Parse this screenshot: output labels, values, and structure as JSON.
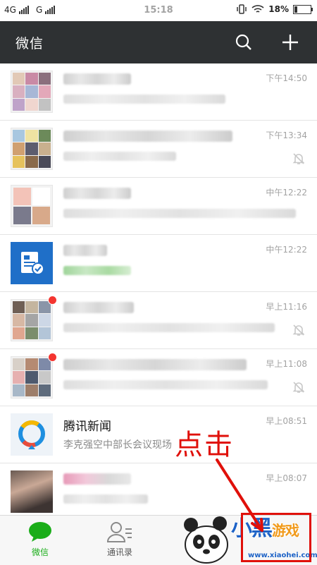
{
  "status_bar": {
    "carrier1": "4G",
    "carrier2": "G",
    "time": "15:18",
    "battery": "18%",
    "battery_level": 0.18
  },
  "app_bar": {
    "title": "微信"
  },
  "chats": [
    {
      "time": "下午14:50",
      "muted": false,
      "unread_dot": false
    },
    {
      "time": "下午13:34",
      "muted": true,
      "unread_dot": false
    },
    {
      "time": "中午12:22",
      "muted": false,
      "unread_dot": false
    },
    {
      "time": "中午12:22",
      "muted": false,
      "unread_dot": false
    },
    {
      "time": "早上11:16",
      "muted": true,
      "unread_dot": true
    },
    {
      "time": "早上11:08",
      "muted": true,
      "unread_dot": true
    },
    {
      "name": "腾讯新闻",
      "snippet": "李克强空中部长会议现场",
      "time": "早上08:51",
      "muted": false,
      "unread_dot": false
    },
    {
      "time": "早上08:07",
      "muted": false,
      "unread_dot": false
    }
  ],
  "tabs": [
    {
      "label": "微信",
      "active": true
    },
    {
      "label": "通讯录",
      "active": false
    }
  ],
  "annotation": {
    "text": "点击"
  },
  "watermark": {
    "brand_a": "小黑",
    "brand_b": "游戏",
    "url": "www.xiaohei.com"
  },
  "colors": {
    "accent": "#1aad19",
    "appbar": "#2e3133",
    "annotation": "#e0100a"
  }
}
